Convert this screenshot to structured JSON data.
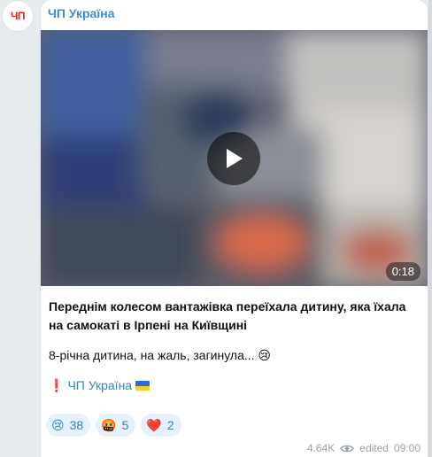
{
  "channel": {
    "name": "ЧП Україна",
    "avatar_text": "ЧП"
  },
  "video": {
    "duration": "0:18"
  },
  "message": {
    "headline": "Переднім колесом вантажівка переїхала дитину, яка їхала на самокаті в Ірпені на Київщині",
    "body": "8-річна дитина, на жаль, загинула... 😢",
    "signature_mark": "❗",
    "signature_link": "ЧП Україна"
  },
  "reactions": [
    {
      "emoji": "😢",
      "count": "38"
    },
    {
      "emoji": "🤬",
      "count": "5"
    },
    {
      "emoji": "❤️",
      "count": "2"
    }
  ],
  "footer": {
    "views": "4.64K",
    "edited": "edited",
    "time": "09:00"
  },
  "colors": {
    "link": "#3d8ed1",
    "avatar_text": "#d9272e",
    "reaction_bg": "#e6f1fb"
  }
}
